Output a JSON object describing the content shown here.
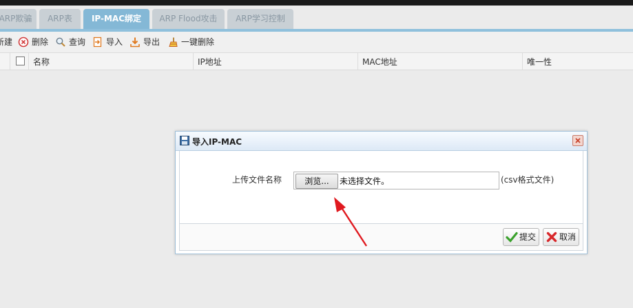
{
  "tabs": [
    {
      "label": "ARP欺骗",
      "active": false
    },
    {
      "label": "ARP表",
      "active": false
    },
    {
      "label": "IP-MAC绑定",
      "active": true
    },
    {
      "label": "ARP Flood攻击",
      "active": false
    },
    {
      "label": "ARP学习控制",
      "active": false
    }
  ],
  "toolbar": {
    "new_label": "新建",
    "delete_label": "删除",
    "query_label": "查询",
    "import_label": "导入",
    "export_label": "导出",
    "delete_all_label": "一键删除"
  },
  "table": {
    "columns": [
      "名称",
      "IP地址",
      "MAC地址",
      "唯一性"
    ]
  },
  "dialog": {
    "title": "导入IP-MAC",
    "upload_label": "上传文件名称",
    "browse_label": "浏览...",
    "no_file_text": "未选择文件。",
    "hint": "(csv格式文件)",
    "submit_label": "提交",
    "cancel_label": "取消"
  },
  "icons": [
    "delete-icon",
    "search-icon",
    "import-icon",
    "export-icon",
    "broom-icon",
    "save-icon",
    "close-icon",
    "check-icon",
    "cancel-icon"
  ],
  "colors": {
    "active_tab": "#84b8d6",
    "inactive_tab": "#c9d0d5",
    "annotation_arrow": "#e0191f"
  }
}
